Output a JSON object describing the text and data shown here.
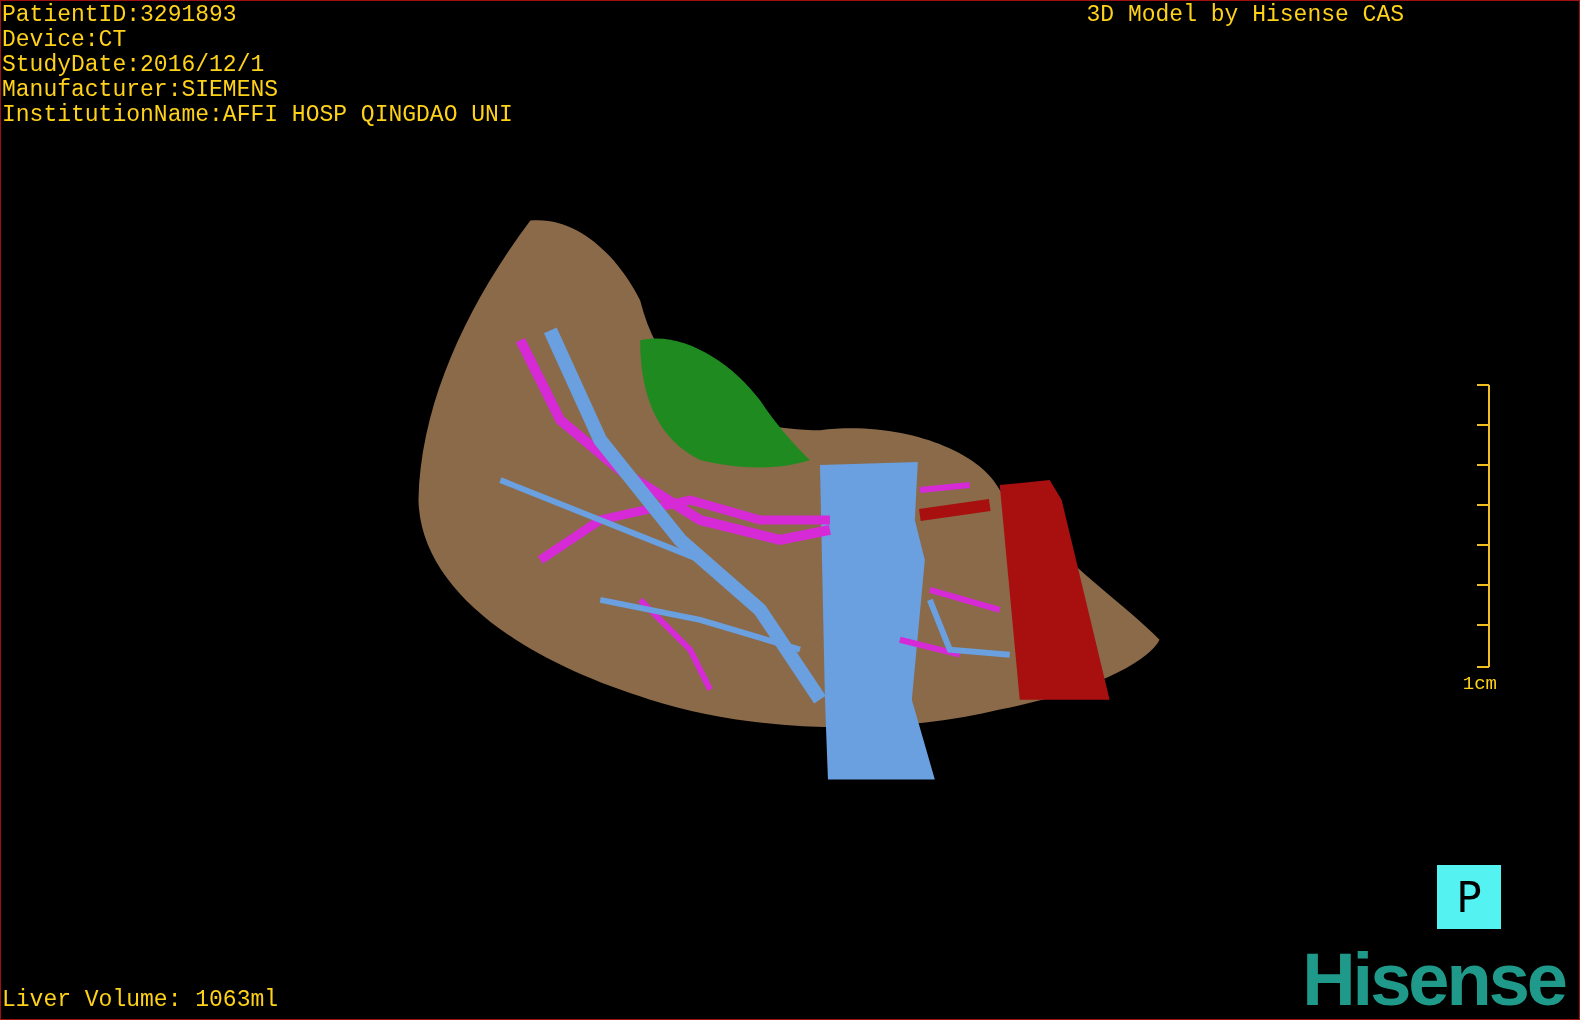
{
  "patient_info": [
    "PatientID:3291893",
    "Device:CT",
    "StudyDate:2016/12/1",
    "Manufacturer:SIEMENS",
    "InstitutionName:AFFI HOSP QINGDAO UNI"
  ],
  "model_credit": "3D Model by Hisense CAS",
  "scale_bar": {
    "label": "1cm"
  },
  "orientation_marker": "P",
  "liver_volume": "Liver Volume: 1063ml",
  "logo": "Hisense"
}
